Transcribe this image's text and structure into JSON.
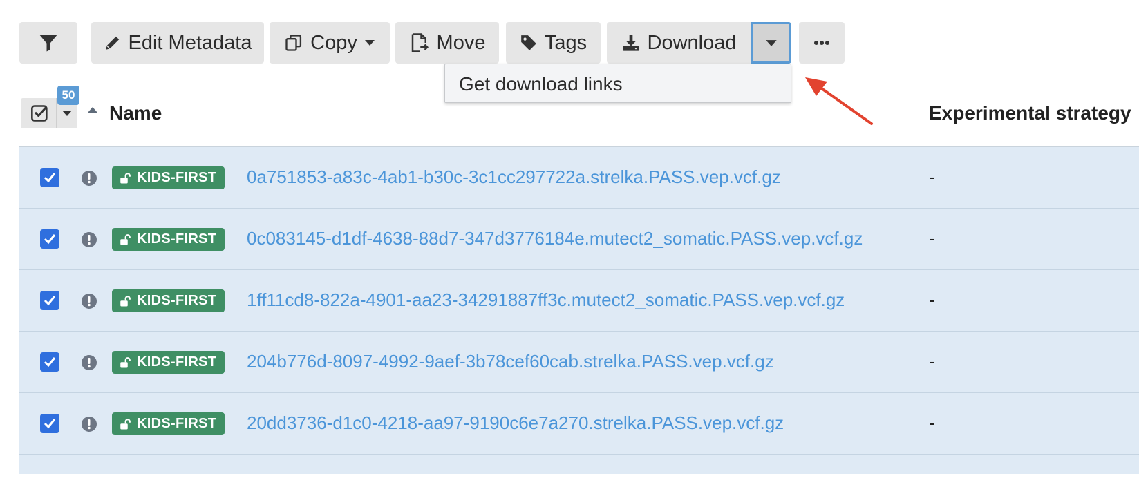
{
  "toolbar": {
    "filter_label": "",
    "edit_metadata_label": "Edit Metadata",
    "copy_label": "Copy",
    "move_label": "Move",
    "tags_label": "Tags",
    "download_label": "Download",
    "more_label": "⋯"
  },
  "download_menu": {
    "items": [
      {
        "label": "Get download links"
      }
    ]
  },
  "table": {
    "selected_count": "50",
    "columns": {
      "name": "Name",
      "experimental_strategy": "Experimental strategy"
    },
    "rows": [
      {
        "checked": true,
        "badge": "KIDS-FIRST",
        "name": "0a751853-a83c-4ab1-b30c-3c1cc297722a.strelka.PASS.vep.vcf.gz",
        "experimental_strategy": "-"
      },
      {
        "checked": true,
        "badge": "KIDS-FIRST",
        "name": "0c083145-d1df-4638-88d7-347d3776184e.mutect2_somatic.PASS.vep.vcf.gz",
        "experimental_strategy": "-"
      },
      {
        "checked": true,
        "badge": "KIDS-FIRST",
        "name": "1ff11cd8-822a-4901-aa23-34291887ff3c.mutect2_somatic.PASS.vep.vcf.gz",
        "experimental_strategy": "-"
      },
      {
        "checked": true,
        "badge": "KIDS-FIRST",
        "name": "204b776d-8097-4992-9aef-3b78cef60cab.strelka.PASS.vep.vcf.gz",
        "experimental_strategy": "-"
      },
      {
        "checked": true,
        "badge": "KIDS-FIRST",
        "name": "20dd3736-d1c0-4218-aa97-9190c6e7a270.strelka.PASS.vep.vcf.gz",
        "experimental_strategy": "-"
      }
    ]
  },
  "icons": {
    "filter": "funnel-icon",
    "edit": "pencil-icon",
    "copy": "copy-icon",
    "move": "move-file-icon",
    "tags": "tag-icon",
    "download": "download-icon",
    "row_warning": "exclamation-circle-icon",
    "row_badge": "unlock-icon"
  },
  "colors": {
    "selection_row_bg": "#dfeaf5",
    "badge_green": "#3f8f64",
    "link_blue": "#4b95d9",
    "checkbox_blue": "#2f6fde",
    "focus_border": "#5b9bd5",
    "annotation_arrow": "#e2432f"
  }
}
